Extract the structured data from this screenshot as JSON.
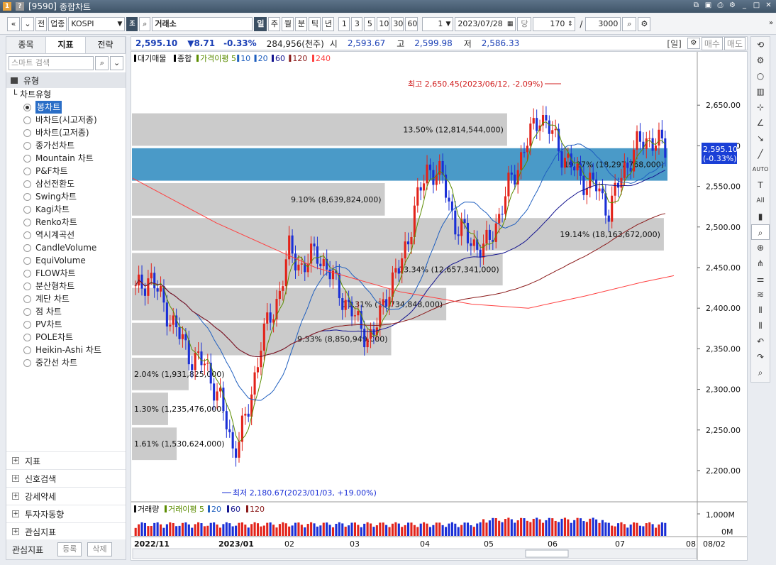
{
  "window": {
    "code": "[9590]",
    "title": "종합차트",
    "badge_one": "1",
    "badge_q": "?"
  },
  "toolbar": {
    "nav_prev": "«",
    "nav_down": "»",
    "btn_jeon": "전",
    "btn_upjong": "업종",
    "market": "KOSPI",
    "exchange": "거래소",
    "periods": [
      "일",
      "주",
      "월",
      "분",
      "틱",
      "년"
    ],
    "active_period": "일",
    "intervals": [
      "1",
      "3",
      "5",
      "10",
      "30",
      "60"
    ],
    "unit_value": "1",
    "date": "2023/07/28",
    "btn_dang": "당",
    "count": "170",
    "slash": "/",
    "total": "3000"
  },
  "left_panel": {
    "tabs": [
      "종목",
      "지표",
      "전략"
    ],
    "active_tab": "지표",
    "search_placeholder": "스마트 검색",
    "type_header": "유형",
    "tree_root": "차트유형",
    "chart_types": [
      "봉차트",
      "바차트(시고저종)",
      "바차트(고저종)",
      "종가선차트",
      "Mountain 차트",
      "P&F차트",
      "삼선전환도",
      "Swing차트",
      "Kagi차트",
      "Renko차트",
      "역시계곡선",
      "CandleVolume",
      "EquiVolume",
      "FLOW차트",
      "분산형차트",
      "계단 차트",
      "점 차트",
      "PV차트",
      "POLE차트",
      "Heikin-Ashi 차트",
      "중간선 차트"
    ],
    "selected_type": "봉차트",
    "sections": [
      "지표",
      "신호검색",
      "강세약세",
      "투자자동향",
      "관심지표"
    ],
    "footer_label": "관심지표",
    "footer_buttons": [
      "등록",
      "삭제"
    ]
  },
  "info_bar": {
    "price": "2,595.10",
    "change": "▼8.71",
    "change_pct": "-0.33%",
    "volume": "284,956(천주)",
    "open_label": "시",
    "open": "2,593.67",
    "high_label": "고",
    "high": "2,599.98",
    "low_label": "저",
    "low": "2,586.33",
    "period_tag": "[일]",
    "buy": "매수",
    "sell": "매도"
  },
  "chart_data": {
    "type": "candlestick",
    "legend_price": [
      "대기매물",
      "종합",
      "가격이평 5",
      "10",
      "20",
      "60",
      "120",
      "240"
    ],
    "legend_colors": [
      "#000000",
      "#000000",
      "#5b8c00",
      "#1f5fbf",
      "#1f5fbf",
      "#14148f",
      "#8b1a1a",
      "#ff4040"
    ],
    "legend_volume": [
      "거래량",
      "거래이평 5",
      "20",
      "60",
      "120"
    ],
    "y_ticks": [
      2650,
      2600,
      2550,
      2500,
      2450,
      2400,
      2350,
      2300,
      2250,
      2200
    ],
    "y_tick_labels": [
      "2,650.00",
      "2,600.00",
      "2,550.00",
      "2,500.00",
      "2,450.00",
      "2,400.00",
      "2,350.00",
      "2,300.00",
      "2,250.00",
      "2,200.00"
    ],
    "ylim": [
      2165,
      2700
    ],
    "last_price_label": "2,595.10",
    "last_change_label": "(-0.33%)",
    "high_annotation": "최고 2,650.45(2023/06/12, -2.09%)",
    "low_annotation": "최저 2,180.67(2023/01/03, +19.00%)",
    "x_labels": [
      "2022/11",
      "2023/01",
      "02",
      "03",
      "04",
      "05",
      "06",
      "07",
      "08"
    ],
    "x_end_label": "08/02",
    "volume_ticks": [
      "1,000M",
      "0M"
    ],
    "volume_profile": [
      {
        "low": 2600,
        "high": 2640,
        "label": "13.50% (12,814,544,000)",
        "pct": 13.5
      },
      {
        "low": 2557,
        "high": 2597,
        "label": "19.27% (18,297,768,000)",
        "pct": 19.27,
        "highlight": true
      },
      {
        "low": 2514,
        "high": 2554,
        "label": "9.10% (8,639,824,000)",
        "pct": 9.1
      },
      {
        "low": 2471,
        "high": 2511,
        "label": "19.14% (18,163,672,000)",
        "pct": 19.14
      },
      {
        "low": 2428,
        "high": 2468,
        "label": "13.34% (12,657,341,000)",
        "pct": 13.34
      },
      {
        "low": 2385,
        "high": 2425,
        "label": "11.31% (10,734,848,000)",
        "pct": 11.31
      },
      {
        "low": 2342,
        "high": 2382,
        "label": "9.33% (8,850,949,000)",
        "pct": 9.33
      },
      {
        "low": 2299,
        "high": 2339,
        "label": "2.04% (1,931,825,000)",
        "pct": 2.04
      },
      {
        "low": 2256,
        "high": 2296,
        "label": "1.30% (1,235,476,000)",
        "pct": 1.3
      },
      {
        "low": 2213,
        "high": 2253,
        "label": "1.61% (1,530,624,000)",
        "pct": 1.61
      }
    ],
    "key_closes": [
      2420,
      2440,
      2405,
      2370,
      2340,
      2330,
      2290,
      2225,
      2265,
      2360,
      2400,
      2470,
      2450,
      2470,
      2440,
      2410,
      2380,
      2360,
      2420,
      2450,
      2520,
      2575,
      2560,
      2500,
      2485,
      2470,
      2510,
      2560,
      2600,
      2640,
      2610,
      2580,
      2560,
      2550,
      2520,
      2570,
      2600,
      2610,
      2595
    ]
  }
}
